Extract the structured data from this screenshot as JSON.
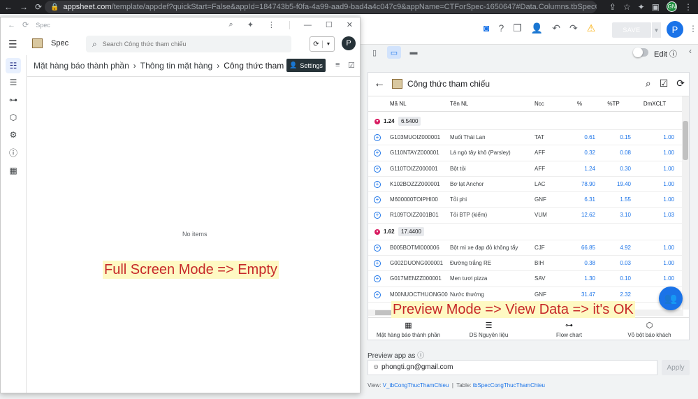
{
  "browser": {
    "url_host": "appsheet.com",
    "url_path": "/template/appdef?quickStart=False&appId=184743b5-f0fa-4a99-aad9-bad4a4c047c9&appName=CTForSpec-1650647#Data.Columns.tbSpecCongThucThamChieu",
    "profile_initials": "GN"
  },
  "editor": {
    "save_label": "SAVE",
    "avatar_letter": "P",
    "edit_label": "Edit"
  },
  "app_window": {
    "title": "Spec",
    "app_name": "Spec",
    "search_placeholder": "Search Công thức tham chiếu",
    "avatar_letter": "P",
    "breadcrumbs": [
      "Mặt hàng báo thành phần",
      "Thông tin mặt hàng",
      "Công thức tham chiếu"
    ],
    "settings_label": "Settings",
    "empty_text": "No items",
    "annotation": "Full Screen Mode => Empty"
  },
  "preview": {
    "title": "Công thức tham chiếu",
    "columns": [
      "Mã NL",
      "Tên NL",
      "Ncc",
      "%",
      "%TP",
      "DmXCLT"
    ],
    "groups": [
      {
        "key": "1.24",
        "value": "6.5400",
        "rows": [
          {
            "ma": "G103MUOIZ000001",
            "ten": "Muối Thái Lan",
            "ncc": "TAT",
            "pct": "0.61",
            "tp": "0.15",
            "dm": "1.00"
          },
          {
            "ma": "G110NTAYZ000001",
            "ten": "Lá ngò tây khô (Parsley)",
            "ncc": "AFF",
            "pct": "0.32",
            "tp": "0.08",
            "dm": "1.00"
          },
          {
            "ma": "G110TOIZZ000001",
            "ten": "Bột tỏi",
            "ncc": "AFF",
            "pct": "1.24",
            "tp": "0.30",
            "dm": "1.00"
          },
          {
            "ma": "K102BOZZZ000001",
            "ten": "Bơ lạt Anchor",
            "ncc": "LAC",
            "pct": "78.90",
            "tp": "19.40",
            "dm": "1.00"
          },
          {
            "ma": "M600000TOIPHI00",
            "ten": "Tỏi phi",
            "ncc": "GNF",
            "pct": "6.31",
            "tp": "1.55",
            "dm": "1.00"
          },
          {
            "ma": "R109TOIZZ001B01",
            "ten": "Tỏi BTP (kiểm)",
            "ncc": "VUM",
            "pct": "12.62",
            "tp": "3.10",
            "dm": "1.03"
          }
        ]
      },
      {
        "key": "1.62",
        "value": "17.4400",
        "rows": [
          {
            "ma": "B005BOTMI000006",
            "ten": "Bột mì xe đạp đỏ không tẩy",
            "ncc": "CJF",
            "pct": "66.85",
            "tp": "4.92",
            "dm": "1.00"
          },
          {
            "ma": "G002DUONG000001",
            "ten": "Đường trắng RE",
            "ncc": "BIH",
            "pct": "0.38",
            "tp": "0.03",
            "dm": "1.00"
          },
          {
            "ma": "G017MENZZ000001",
            "ten": "Men tươi pizza",
            "ncc": "SAV",
            "pct": "1.30",
            "tp": "0.10",
            "dm": "1.00"
          },
          {
            "ma": "M00NUOCTHUONG00",
            "ten": "Nước thường",
            "ncc": "GNF",
            "pct": "31.47",
            "tp": "2.32",
            "dm": ""
          }
        ]
      }
    ],
    "nav": [
      "Mặt hàng báo thành phần",
      "DS Nguyên liệu",
      "Flow chart",
      "Vỏ bột báo khách"
    ],
    "annotation": "Preview Mode => View Data => it's OK"
  },
  "preview_as": {
    "label": "Preview app as",
    "email": "phongti.gn@gmail.com",
    "apply_label": "Apply"
  },
  "footer": {
    "view_label": "View:",
    "view_name": "V_tbCongThucThamChieu",
    "table_label": "Table:",
    "table_name": "tbSpecCongThucThamChieu"
  },
  "colors": {
    "primary_blue": "#1a73e8",
    "annotation_red": "#c62828",
    "annotation_bg": "#fef9c3",
    "settings_dark": "#263238"
  }
}
